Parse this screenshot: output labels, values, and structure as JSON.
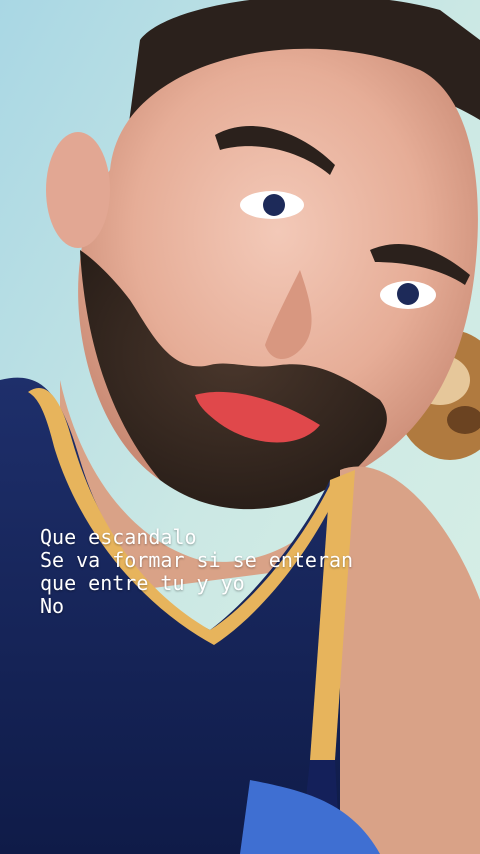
{
  "story": {
    "photo_alt": "",
    "caption_lines": [
      "Que escandalo",
      "Se va formar si se enteran",
      "que entre tu y yo",
      "No"
    ]
  }
}
